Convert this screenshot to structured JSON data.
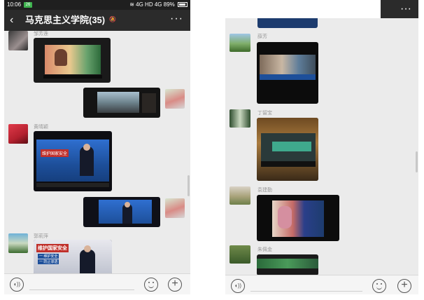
{
  "left": {
    "status": {
      "time": "10:06",
      "badge": "26",
      "signal": "4G",
      "hd": "HD",
      "signal2": "4G",
      "battery": "89%"
    },
    "title": "马克思主义学院(35)",
    "more": "···",
    "messages": [
      {
        "sender": "邹芳莲",
        "side": "left"
      },
      {
        "sender": "",
        "side": "right"
      },
      {
        "sender": "黄晴颖",
        "side": "left",
        "screen_text": "维护国家安全"
      },
      {
        "sender": "",
        "side": "right"
      },
      {
        "sender": "郭莉萍",
        "side": "left",
        "screen_text": "维护国家安全",
        "screen_lines": [
          "一 维护安全",
          "一 防止渗透"
        ]
      }
    ]
  },
  "right": {
    "more": "···",
    "messages": [
      {
        "sender": "薛芳"
      },
      {
        "sender": "丁留宝"
      },
      {
        "sender": "袁建勤"
      },
      {
        "sender": "朱佩金"
      }
    ]
  },
  "colors": {
    "chat_bg": "#ebebeb",
    "titlebar": "#2b2b2b",
    "tv_blue": "#1d4f9a",
    "tv_red": "#c0302b"
  }
}
